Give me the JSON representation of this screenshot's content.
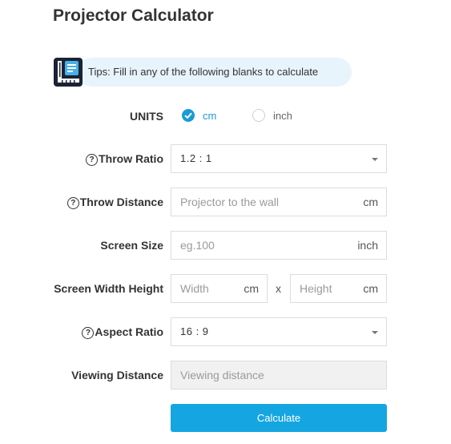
{
  "title": "Projector Calculator",
  "tips": {
    "text": "Tips: Fill in any of the following blanks to calculate"
  },
  "units": {
    "label": "UNITS",
    "options": [
      "cm",
      "inch"
    ],
    "selected": "cm"
  },
  "throw_ratio": {
    "label": "Throw Ratio",
    "value": "1.2 : 1"
  },
  "throw_distance": {
    "label": "Throw Distance",
    "placeholder": "Projector to the wall",
    "unit": "cm"
  },
  "screen_size": {
    "label": "Screen Size",
    "placeholder": "eg.100",
    "unit": "inch"
  },
  "screen_wh": {
    "label": "Screen Width Height",
    "width_placeholder": "Width",
    "width_unit": "cm",
    "separator": "x",
    "height_placeholder": "Height",
    "height_unit": "cm"
  },
  "aspect_ratio": {
    "label": "Aspect Ratio",
    "value": "16 : 9"
  },
  "viewing_distance": {
    "label": "Viewing Distance",
    "placeholder": "Viewing distance"
  },
  "calculate_label": "Calculate",
  "help_glyph": "?",
  "colors": {
    "accent": "#15a6e2",
    "icon_bg": "#1b2235"
  }
}
